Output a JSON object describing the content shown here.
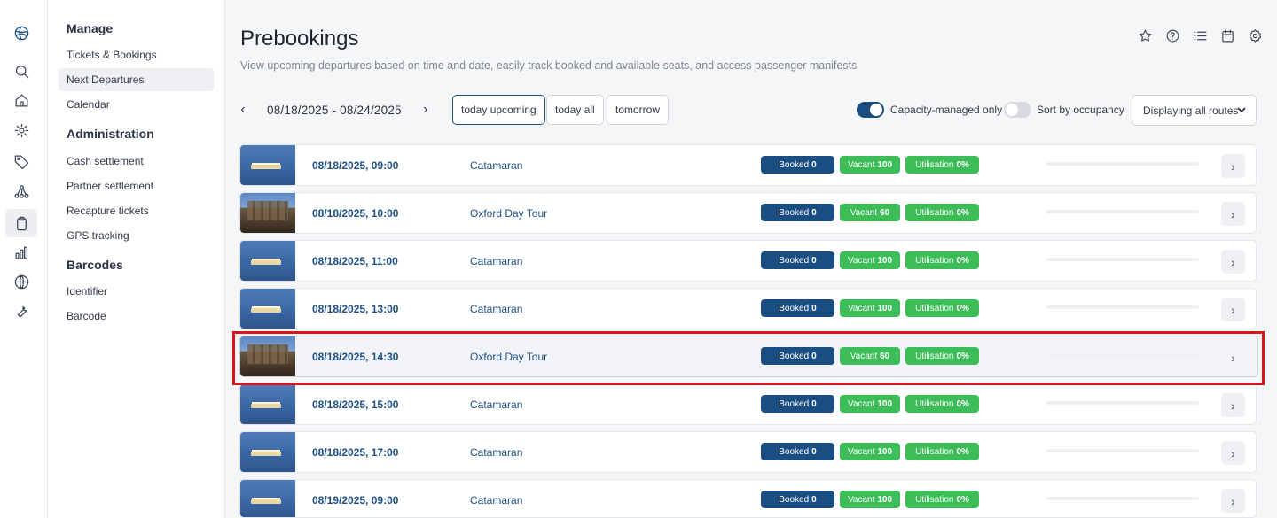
{
  "rail": {
    "icons": [
      "globe-logo-icon",
      "search-icon",
      "home-icon",
      "gear-icon",
      "tag-icon",
      "network-icon",
      "clipboard-icon",
      "bar-chart-icon",
      "globe-icon",
      "wrench-icon"
    ]
  },
  "sidebar": {
    "sections": [
      {
        "title": "Manage",
        "items": [
          "Tickets & Bookings",
          "Next Departures",
          "Calendar"
        ]
      },
      {
        "title": "Administration",
        "items": [
          "Cash settlement",
          "Partner settlement",
          "Recapture tickets",
          "GPS tracking"
        ]
      },
      {
        "title": "Barcodes",
        "items": [
          "Identifier",
          "Barcode"
        ]
      }
    ],
    "active_item": "Next Departures"
  },
  "header": {
    "title": "Prebookings",
    "subtitle": "View upcoming departures based on time and date, easily track booked and available seats, and access passenger manifests",
    "icons": [
      "star-icon",
      "help-icon",
      "list-icon",
      "calendar-icon",
      "settings-icon"
    ]
  },
  "filters": {
    "prev": "‹",
    "next": "›",
    "date_range": "08/18/2025 - 08/24/2025",
    "chips": [
      "today upcoming",
      "today all",
      "tomorrow"
    ],
    "active_chip": "today upcoming",
    "capacity_toggle": {
      "label": "Capacity-managed only",
      "on": true
    },
    "occupancy_toggle": {
      "label": "Sort by occupancy",
      "on": false
    },
    "route_select": "Displaying all routes"
  },
  "colors": {
    "primary": "#1a4e82",
    "success": "#3cbd58",
    "highlight_border": "#d7141c"
  },
  "departures": [
    {
      "time": "08/18/2025, 09:00",
      "route": "Catamaran",
      "booked_label": "Booked",
      "booked": "0",
      "vacant_label": "Vacant",
      "vacant": "100",
      "util_label": "Utilisation",
      "util": "0%",
      "image": "boat"
    },
    {
      "time": "08/18/2025, 10:00",
      "route": "Oxford Day Tour",
      "booked_label": "Booked",
      "booked": "0",
      "vacant_label": "Vacant",
      "vacant": "60",
      "util_label": "Utilisation",
      "util": "0%",
      "image": "castle"
    },
    {
      "time": "08/18/2025, 11:00",
      "route": "Catamaran",
      "booked_label": "Booked",
      "booked": "0",
      "vacant_label": "Vacant",
      "vacant": "100",
      "util_label": "Utilisation",
      "util": "0%",
      "image": "boat"
    },
    {
      "time": "08/18/2025, 13:00",
      "route": "Catamaran",
      "booked_label": "Booked",
      "booked": "0",
      "vacant_label": "Vacant",
      "vacant": "100",
      "util_label": "Utilisation",
      "util": "0%",
      "image": "boat"
    },
    {
      "time": "08/18/2025, 14:30",
      "route": "Oxford Day Tour",
      "booked_label": "Booked",
      "booked": "0",
      "vacant_label": "Vacant",
      "vacant": "60",
      "util_label": "Utilisation",
      "util": "0%",
      "image": "castle"
    },
    {
      "time": "08/18/2025, 15:00",
      "route": "Catamaran",
      "booked_label": "Booked",
      "booked": "0",
      "vacant_label": "Vacant",
      "vacant": "100",
      "util_label": "Utilisation",
      "util": "0%",
      "image": "boat"
    },
    {
      "time": "08/18/2025, 17:00",
      "route": "Catamaran",
      "booked_label": "Booked",
      "booked": "0",
      "vacant_label": "Vacant",
      "vacant": "100",
      "util_label": "Utilisation",
      "util": "0%",
      "image": "boat"
    },
    {
      "time": "08/19/2025, 09:00",
      "route": "Catamaran",
      "booked_label": "Booked",
      "booked": "0",
      "vacant_label": "Vacant",
      "vacant": "100",
      "util_label": "Utilisation",
      "util": "0%",
      "image": "boat"
    }
  ],
  "highlighted_row": 4,
  "row_action": "›"
}
